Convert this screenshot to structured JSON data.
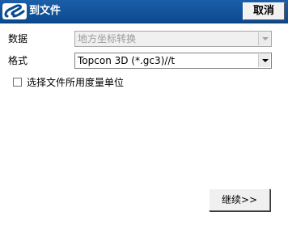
{
  "window": {
    "title": "到文件",
    "logo_icon": "company-logo-icon",
    "title_bar_color": "#0f4f96"
  },
  "toolbar": {
    "cancel_label": "取消"
  },
  "form": {
    "data_label": "数据",
    "data_value": "地方坐标转换",
    "data_disabled": true,
    "format_label": "格式",
    "format_value": "Topcon 3D (*.gc3)//t",
    "unit_checkbox_label": "选择文件所用度量单位",
    "unit_checkbox_checked": false
  },
  "footer": {
    "continue_label": "继续>>"
  }
}
